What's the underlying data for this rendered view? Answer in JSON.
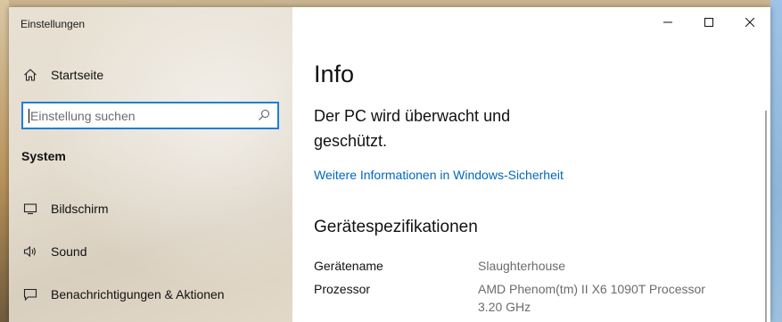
{
  "window": {
    "title": "Einstellungen",
    "controls": [
      "minimize-icon",
      "maximize-icon",
      "close-icon"
    ]
  },
  "sidebar": {
    "home_label": "Startseite",
    "search": {
      "placeholder": "Einstellung suchen",
      "value": ""
    },
    "section_header": "System",
    "items": [
      {
        "label": "Bildschirm",
        "icon": "monitor-icon"
      },
      {
        "label": "Sound",
        "icon": "speaker-icon"
      },
      {
        "label": "Benachrichtigungen & Aktionen",
        "icon": "notification-icon"
      }
    ]
  },
  "main": {
    "title": "Info",
    "status": "Der PC wird überwacht und geschützt.",
    "security_link": "Weitere Informationen in Windows-Sicherheit",
    "specs_title": "Gerätespezifikationen",
    "specs": [
      {
        "label": "Gerätename",
        "value": "Slaughterhouse"
      },
      {
        "label": "Prozessor",
        "value_lines": [
          "AMD Phenom(tm) II X6 1090T Processor",
          "3.20 GHz"
        ]
      }
    ]
  },
  "colors": {
    "accent": "#0067c0",
    "search_border": "#1e7fd6",
    "secondary_text": "#6b6b6b"
  }
}
